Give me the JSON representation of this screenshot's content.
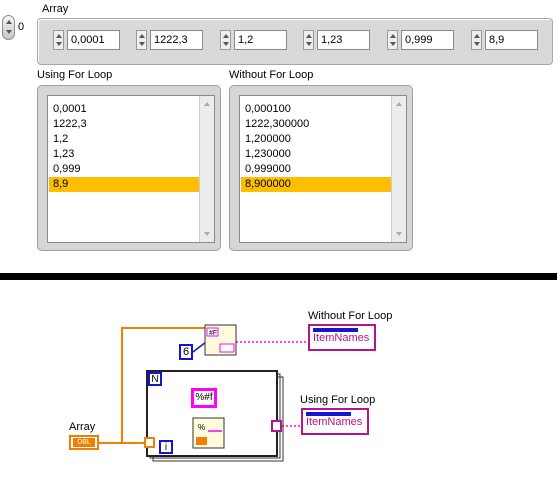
{
  "front_panel": {
    "array_label": "Array",
    "index_value": "0",
    "elements": [
      "0,0001",
      "1222,3",
      "1,2",
      "1,23",
      "0,999",
      "8,9"
    ],
    "list_using": {
      "label": "Using For Loop",
      "items": [
        "0,0001",
        "1222,3",
        "1,2",
        "1,23",
        "0,999",
        "8,9"
      ],
      "selected_index": 5
    },
    "list_without": {
      "label": "Without For Loop",
      "items": [
        "0,000100",
        "1222,300000",
        "1,200000",
        "1,230000",
        "0,999000",
        "8,900000"
      ],
      "selected_index": 5
    },
    "selected_color": "#ffbf00"
  },
  "block_diagram": {
    "array_label": "Array",
    "array_terminal": "DBL",
    "without_label": "Without For Loop",
    "without_terminal": "ItemNames",
    "using_label": "Using For Loop",
    "using_terminal": "ItemNames",
    "count_constant": "6",
    "format_string": "%#f",
    "loop_count_label": "N",
    "loop_index_label": "i",
    "wire_dbl_color": "#f27f00",
    "wire_string_color": "#ff00ff",
    "integer_color": "#1515d0"
  }
}
